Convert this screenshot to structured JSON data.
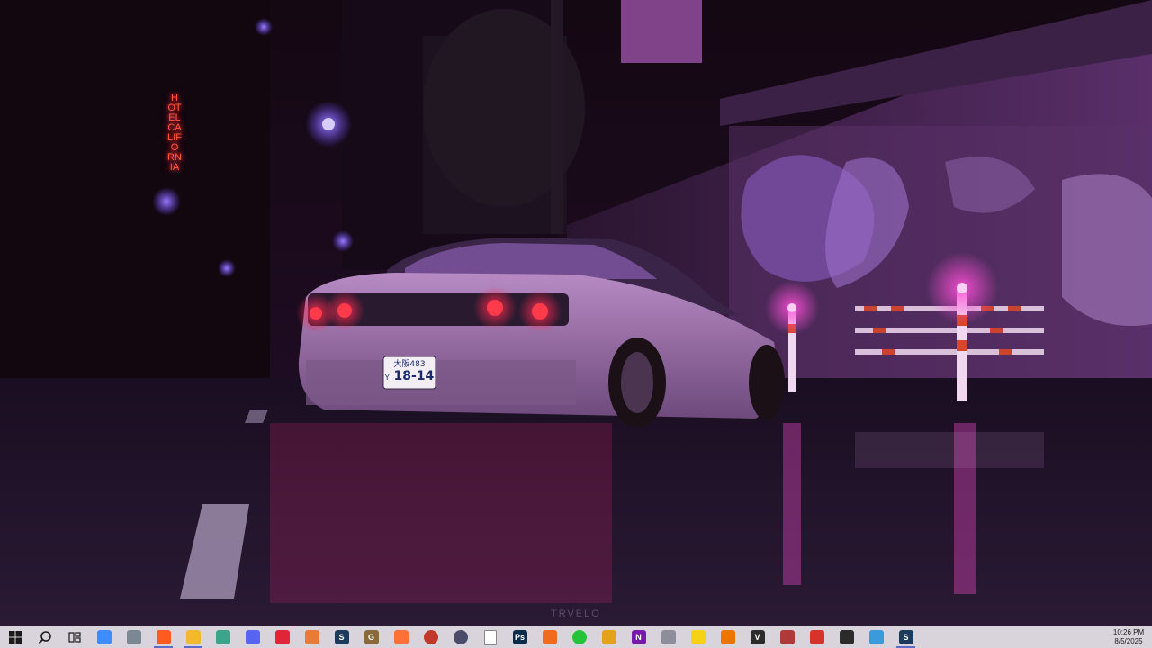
{
  "wallpaper": {
    "hotel_sign": "HOTEL CALIFORNIA",
    "license_plate": {
      "line1": "大阪483",
      "line2": "18-14",
      "prefix": "Y"
    },
    "watermark": "TRVELO"
  },
  "taskbar": {
    "start_icon": "windows-start-icon",
    "search_icon": "search-icon",
    "task_view_icon": "task-view-icon",
    "apps": [
      {
        "name": "copilot-icon",
        "color": "#3f8cff"
      },
      {
        "name": "file-manager-icon",
        "color": "#7b8793"
      },
      {
        "name": "brave-browser-icon",
        "color": "#ff5a1f"
      },
      {
        "name": "file-explorer-icon",
        "color": "#f2b82e"
      },
      {
        "name": "notes-app-icon",
        "color": "#3aa58a"
      },
      {
        "name": "discord-icon",
        "color": "#5865f2"
      },
      {
        "name": "opera-gx-icon",
        "color": "#e0243a"
      },
      {
        "name": "affinity-icon",
        "color": "#e87a3a"
      },
      {
        "name": "steam-icon",
        "color": "#1b3a5c"
      },
      {
        "name": "gimp-icon",
        "color": "#8a6a3a"
      },
      {
        "name": "firefox-icon",
        "color": "#ff7139"
      },
      {
        "name": "app-ring-icon",
        "color": "#c0392b"
      },
      {
        "name": "cortana-icon",
        "color": "#4b4b6a"
      },
      {
        "name": "document-icon",
        "color": "#ffffff"
      },
      {
        "name": "photoshop-icon",
        "color": "#0b2b4a"
      },
      {
        "name": "fl-studio-icon",
        "color": "#f26b1d"
      },
      {
        "name": "razer-icon",
        "color": "#23c43a"
      },
      {
        "name": "sync-icon",
        "color": "#e3a21a"
      },
      {
        "name": "onenote-icon",
        "color": "#7719aa"
      },
      {
        "name": "shield-icon",
        "color": "#8e8e9a"
      },
      {
        "name": "checkmark-app-icon",
        "color": "#f5d216"
      },
      {
        "name": "blender-icon",
        "color": "#ea7600"
      },
      {
        "name": "vegas-icon",
        "color": "#2b2b2b"
      },
      {
        "name": "skull-app-icon",
        "color": "#b03a3a"
      },
      {
        "name": "flash-app-icon",
        "color": "#d6342b"
      },
      {
        "name": "settings-icon",
        "color": "#2b2b2b"
      },
      {
        "name": "remote-desktop-icon",
        "color": "#3b9ad9"
      },
      {
        "name": "steam-icon-2",
        "color": "#1b3a5c"
      }
    ],
    "time": "10:26 PM",
    "date": "8/5/2025"
  }
}
